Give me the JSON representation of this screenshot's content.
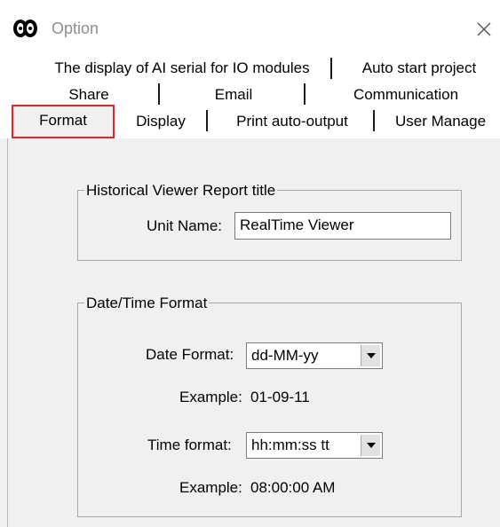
{
  "window": {
    "title": "Option",
    "close_glyph": "✕"
  },
  "tabs": {
    "row1": [
      {
        "label": "The display of AI serial for IO modules"
      },
      {
        "label": "Auto start project"
      }
    ],
    "row2": [
      {
        "label": "Share"
      },
      {
        "label": "Email"
      },
      {
        "label": "Communication"
      }
    ],
    "row3": [
      {
        "label": "Format",
        "selected": true
      },
      {
        "label": "Display"
      },
      {
        "label": "Print auto-output"
      },
      {
        "label": "User Manage"
      }
    ]
  },
  "report_group": {
    "legend": "Historical Viewer Report title",
    "unit_name_label": "Unit Name:",
    "unit_name_value": "RealTime Viewer"
  },
  "datetime_group": {
    "legend": "Date/Time Format",
    "date_format_label": "Date Format:",
    "date_format_value": "dd-MM-yy",
    "date_example_label": "Example:",
    "date_example_value": "01-09-11",
    "time_format_label": "Time format:",
    "time_format_value": "hh:mm:ss tt",
    "time_example_label": "Example:",
    "time_example_value": "08:00:00 AM"
  },
  "icons": {
    "app": "app-icon",
    "close": "close-icon",
    "dropdown": "chevron-down-icon"
  },
  "colors": {
    "selected_tab_highlight": "#e0262a",
    "title_text": "#8e8e8e"
  }
}
